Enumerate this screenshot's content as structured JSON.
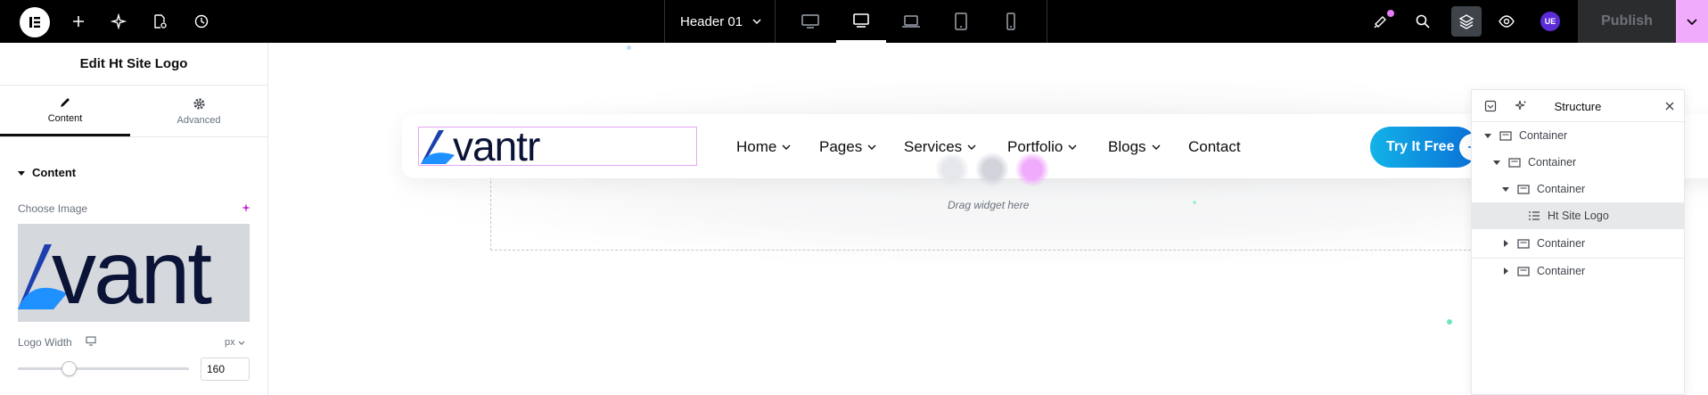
{
  "topbar": {
    "document_title": "Header 01",
    "user_initials": "UE",
    "publish_label": "Publish",
    "icons": [
      "elementor-logo-icon",
      "plus-icon",
      "sparkle-icon",
      "page-settings-icon",
      "history-icon",
      "desktop-icon",
      "tablet-landscape-icon",
      "laptop-icon",
      "tablet-icon",
      "mobile-icon",
      "notification-icon",
      "search-icon",
      "layers-icon",
      "eye-icon",
      "chevron-down-icon"
    ],
    "notification_dot_color": "#e879f9"
  },
  "panel": {
    "title": "Edit Ht Site Logo",
    "tabs": [
      {
        "label": "Content"
      },
      {
        "label": "Advanced"
      }
    ],
    "section_title": "Content",
    "choose_image_label": "Choose Image",
    "image_text": "vant",
    "logo_width_label": "Logo Width",
    "unit": "px",
    "logo_width_value": "160",
    "slider_fraction": 0.3
  },
  "canvas": {
    "logo_text": "vantr",
    "nav": [
      {
        "label": "Home",
        "dropdown": true
      },
      {
        "label": "Pages",
        "dropdown": true
      },
      {
        "label": "Services",
        "dropdown": true
      },
      {
        "label": "Portfolio",
        "dropdown": true
      },
      {
        "label": "Blogs",
        "dropdown": true
      },
      {
        "label": "Contact",
        "dropdown": false
      }
    ],
    "cta_label": "Try It Free",
    "drag_text": "Drag widget here",
    "brand_color": "#0a6fd6",
    "accent_color": "#e879f9"
  },
  "structure": {
    "title": "Structure",
    "items": [
      {
        "label": "Container"
      },
      {
        "label": "Container"
      },
      {
        "label": "Container"
      },
      {
        "label": "Ht Site Logo"
      },
      {
        "label": "Container"
      },
      {
        "label": "Container"
      }
    ]
  }
}
